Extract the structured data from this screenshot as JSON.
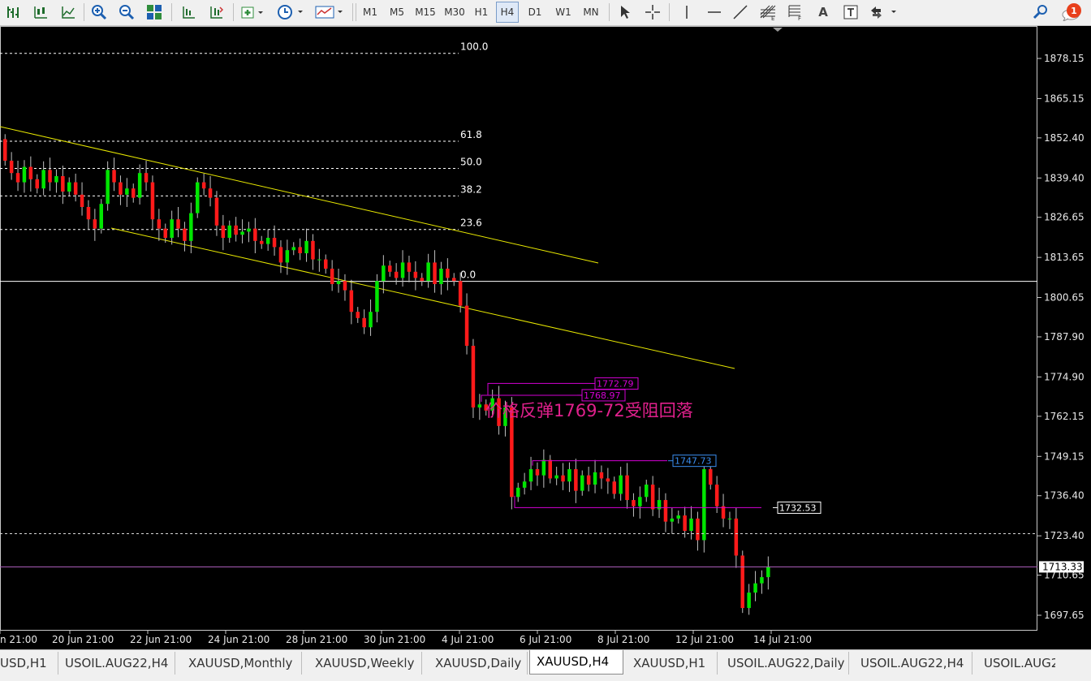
{
  "toolbar": {
    "timeframes": [
      "M1",
      "M5",
      "M15",
      "M30",
      "H1",
      "H4",
      "D1",
      "W1",
      "MN"
    ],
    "active_timeframe": "H4",
    "notification_count": "1",
    "icons": [
      "bar-chart-icon",
      "candlestick-icon",
      "line-chart-icon",
      "zoom-in-icon",
      "zoom-out-icon",
      "tile-windows-icon",
      "auto-scroll-icon",
      "chart-shift-icon",
      "indicators-icon",
      "periods-clock-icon",
      "templates-icon",
      "cursor-icon",
      "crosshair-icon",
      "vertical-line-icon",
      "horizontal-line-icon",
      "trendline-icon",
      "fibonacci-icon",
      "text-icon",
      "text-label-icon",
      "arrows-icon",
      "search-icon",
      "chat-icon"
    ]
  },
  "chart": {
    "symbol": "XAUUSD,H4",
    "price_axis": {
      "labels": [
        "1878.15",
        "1865.15",
        "1852.40",
        "1839.40",
        "1826.65",
        "1813.65",
        "1800.65",
        "1787.90",
        "1774.90",
        "1762.15",
        "1749.15",
        "1736.40",
        "1723.40",
        "1710.65",
        "1697.65"
      ]
    },
    "time_axis": {
      "labels": [
        "n 21:00",
        "20 Jun 21:00",
        "22 Jun 21:00",
        "24 Jun 21:00",
        "28 Jun 21:00",
        "30 Jun 21:00",
        "4 Jul 21:00",
        "6 Jul 21:00",
        "8 Jul 21:00",
        "12 Jul 21:00",
        "14 Jul 21:00"
      ]
    },
    "fib_levels": [
      {
        "label": "100.0",
        "price": 1879.8
      },
      {
        "label": "61.8",
        "price": 1851.3
      },
      {
        "label": "50.0",
        "price": 1842.5
      },
      {
        "label": "38.2",
        "price": 1833.6
      },
      {
        "label": "23.6",
        "price": 1822.7
      },
      {
        "label": "0.0",
        "price": 1805.9
      }
    ],
    "current_price": "1713.33",
    "current_price_value": 1713.33,
    "support_level_price": 1724.1,
    "price_labels": [
      {
        "text": "1772.79",
        "price": 1772.79,
        "color": "#d400d4"
      },
      {
        "text": "1768.97",
        "price": 1768.97,
        "color": "#d400d4"
      },
      {
        "text": "1747.73",
        "price": 1747.73,
        "color": "#3a8ef0"
      },
      {
        "text": "1732.53",
        "price": 1732.53,
        "color": "#ffffff"
      }
    ],
    "annotation": "价格反弹1769-72受阻回落",
    "colors": {
      "bull": "#00e600",
      "bear": "#ff1a1a",
      "wick": "#c0c0c0",
      "channel": "#e8e800",
      "fib": "#ffffff",
      "magenta": "#d400d4",
      "annotation": "#e0208c"
    }
  },
  "tabs": [
    "USD,H1",
    "USOIL.AUG22,H4",
    "XAUUSD,Monthly",
    "XAUUSD,Weekly",
    "XAUUSD,Daily",
    "XAUUSD,H4",
    "XAUUSD,H1",
    "USOIL.AUG22,Daily",
    "USOIL.AUG22,H4",
    "USOIL.AUG2"
  ],
  "active_tab": "XAUUSD,H4"
}
